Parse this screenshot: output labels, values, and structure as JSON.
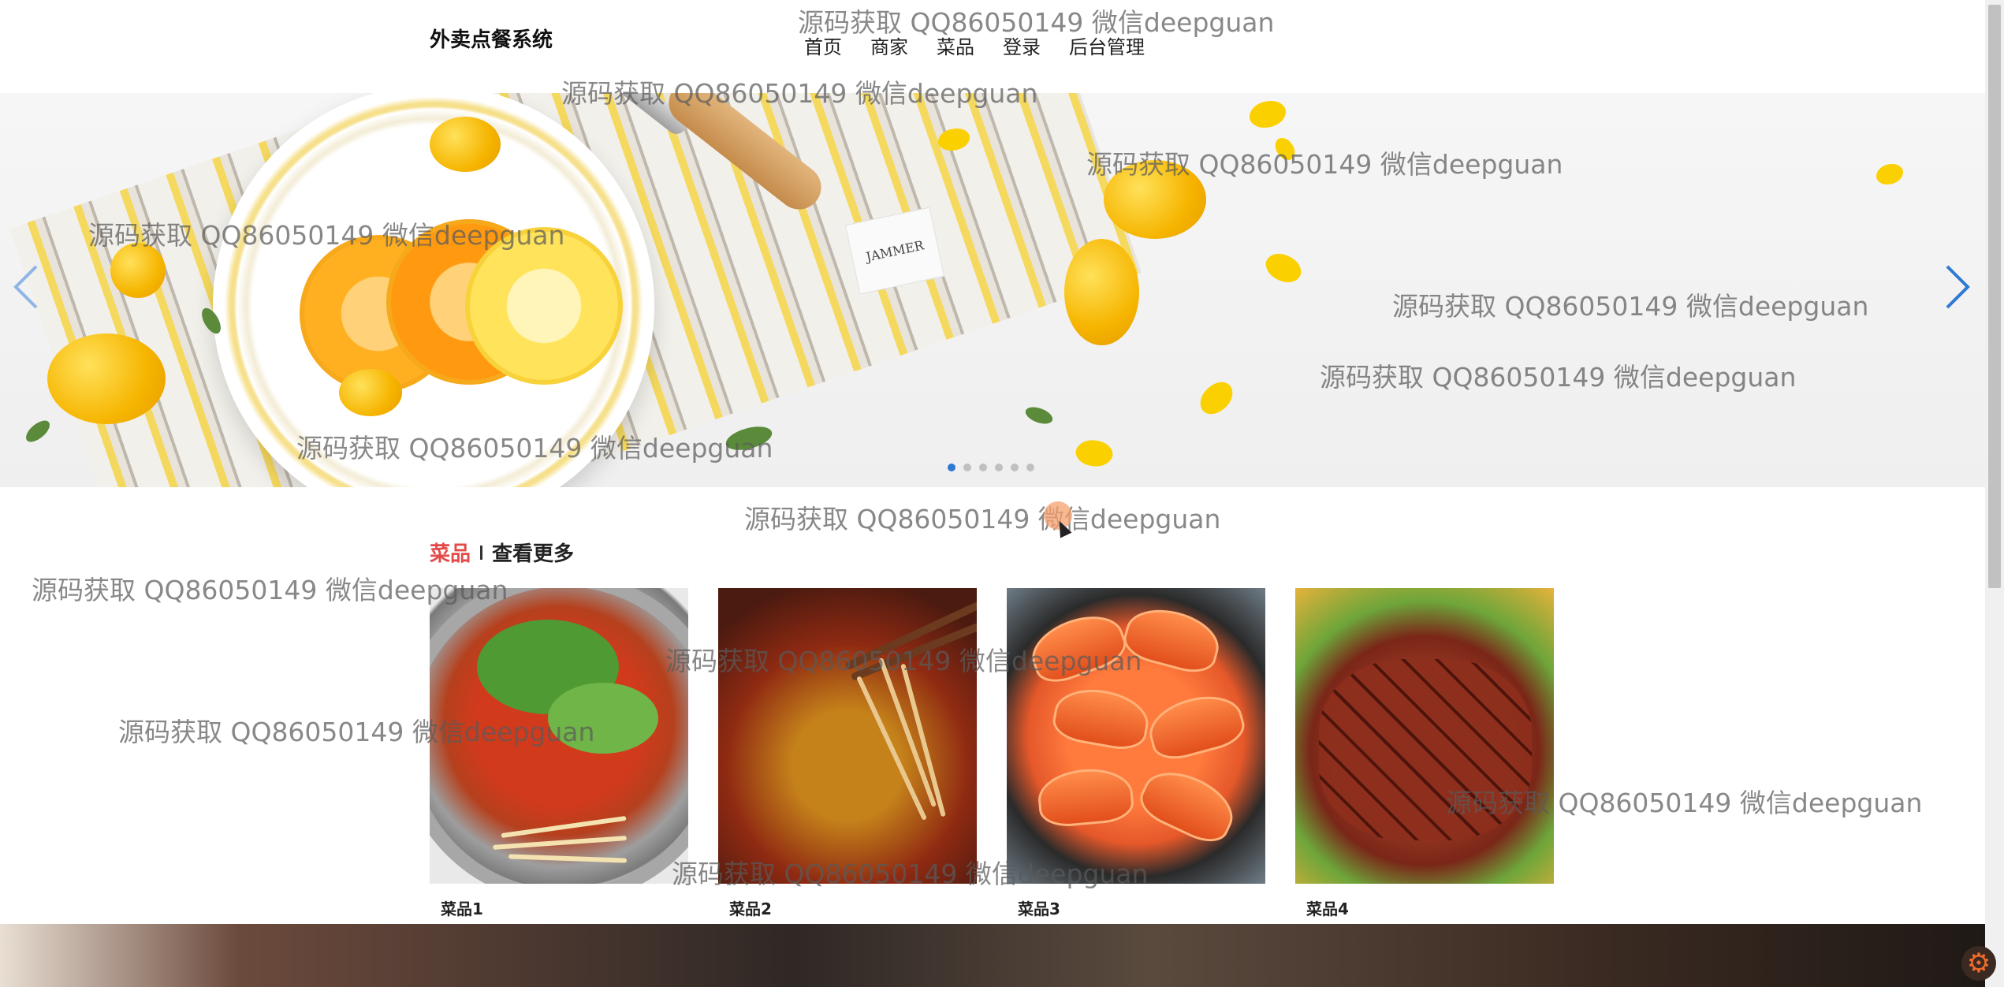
{
  "header": {
    "brand": "外卖点餐系统",
    "nav": [
      "首页",
      "商家",
      "菜品",
      "登录",
      "后台管理"
    ]
  },
  "banner": {
    "tag_text": "JAMMER",
    "prev_icon": "chevron-left-icon",
    "next_icon": "chevron-right-icon",
    "slide_count": 6,
    "active_slide": 1
  },
  "section": {
    "category": "菜品",
    "more": "查看更多"
  },
  "products": [
    {
      "name": "菜品1"
    },
    {
      "name": "菜品2"
    },
    {
      "name": "菜品3"
    },
    {
      "name": "菜品4"
    }
  ],
  "watermark": "源码获取 QQ86050149 微信deepguan",
  "colors": {
    "accent_blue": "#2d79d4",
    "category_red": "#e24a4a",
    "gear_orange": "#f26b2a"
  },
  "floating_icon": "gear-icon"
}
